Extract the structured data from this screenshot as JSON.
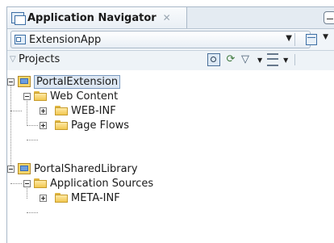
{
  "tab": {
    "title": "Application Navigator"
  },
  "application_selector": {
    "value": "ExtensionApp"
  },
  "accordion": {
    "label": "Projects"
  },
  "tree": {
    "nodes": [
      {
        "label": "PortalExtension"
      },
      {
        "label": "Web Content"
      },
      {
        "label": "WEB-INF"
      },
      {
        "label": "Page Flows"
      },
      {
        "label": "PortalSharedLibrary"
      },
      {
        "label": "Application Sources"
      },
      {
        "label": "META-INF"
      }
    ]
  }
}
